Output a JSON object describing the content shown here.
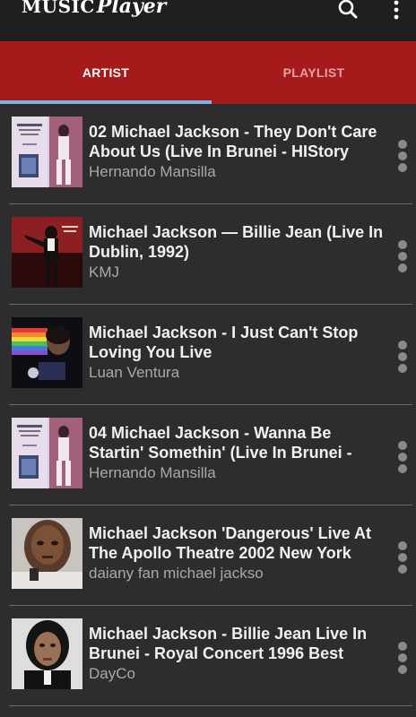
{
  "app": {
    "logo_part1": "Music",
    "logo_part2": "Player"
  },
  "header": {
    "search_icon": "search-icon",
    "menu_icon": "more-vert-icon"
  },
  "tabs": [
    {
      "label": "ARTIST",
      "selected": true
    },
    {
      "label": "PLAYLIST",
      "selected": false
    }
  ],
  "colors": {
    "toolbar": "#1f1f1f",
    "tab_bar": "#a51b1b",
    "tab_indicator": "#7fb0e6",
    "background": "#2d2d2d"
  },
  "songs": [
    {
      "title": "02 Michael Jackson - They Don't Care About Us (Live In Brunei - HIStory",
      "artist": "Hernando Mansilla",
      "thumbnail": "album-cover-live-in-brunei"
    },
    {
      "title": "Michael Jackson — Billie Jean (Live In Dublin, 1992)",
      "artist": "KMJ",
      "thumbnail": "album-cover-billie-jean"
    },
    {
      "title": "Michael Jackson - I Just Can't Stop Loving You Live",
      "artist": "Luan Ventura",
      "thumbnail": "album-cover-rainbow"
    },
    {
      "title": "04 Michael Jackson - Wanna Be Startin' Somethin' (Live In Brunei -",
      "artist": "Hernando Mansilla",
      "thumbnail": "album-cover-live-in-brunei"
    },
    {
      "title": "Michael Jackson   'Dangerous' Live At The Apollo Theatre 2002   New York",
      "artist": "daiany fan michael jackso",
      "thumbnail": "album-cover-dangerous"
    },
    {
      "title": "Michael Jackson - Billie Jean Live In Brunei - Royal Concert 1996 Best",
      "artist": "DayCo",
      "thumbnail": "album-cover-portrait"
    }
  ]
}
